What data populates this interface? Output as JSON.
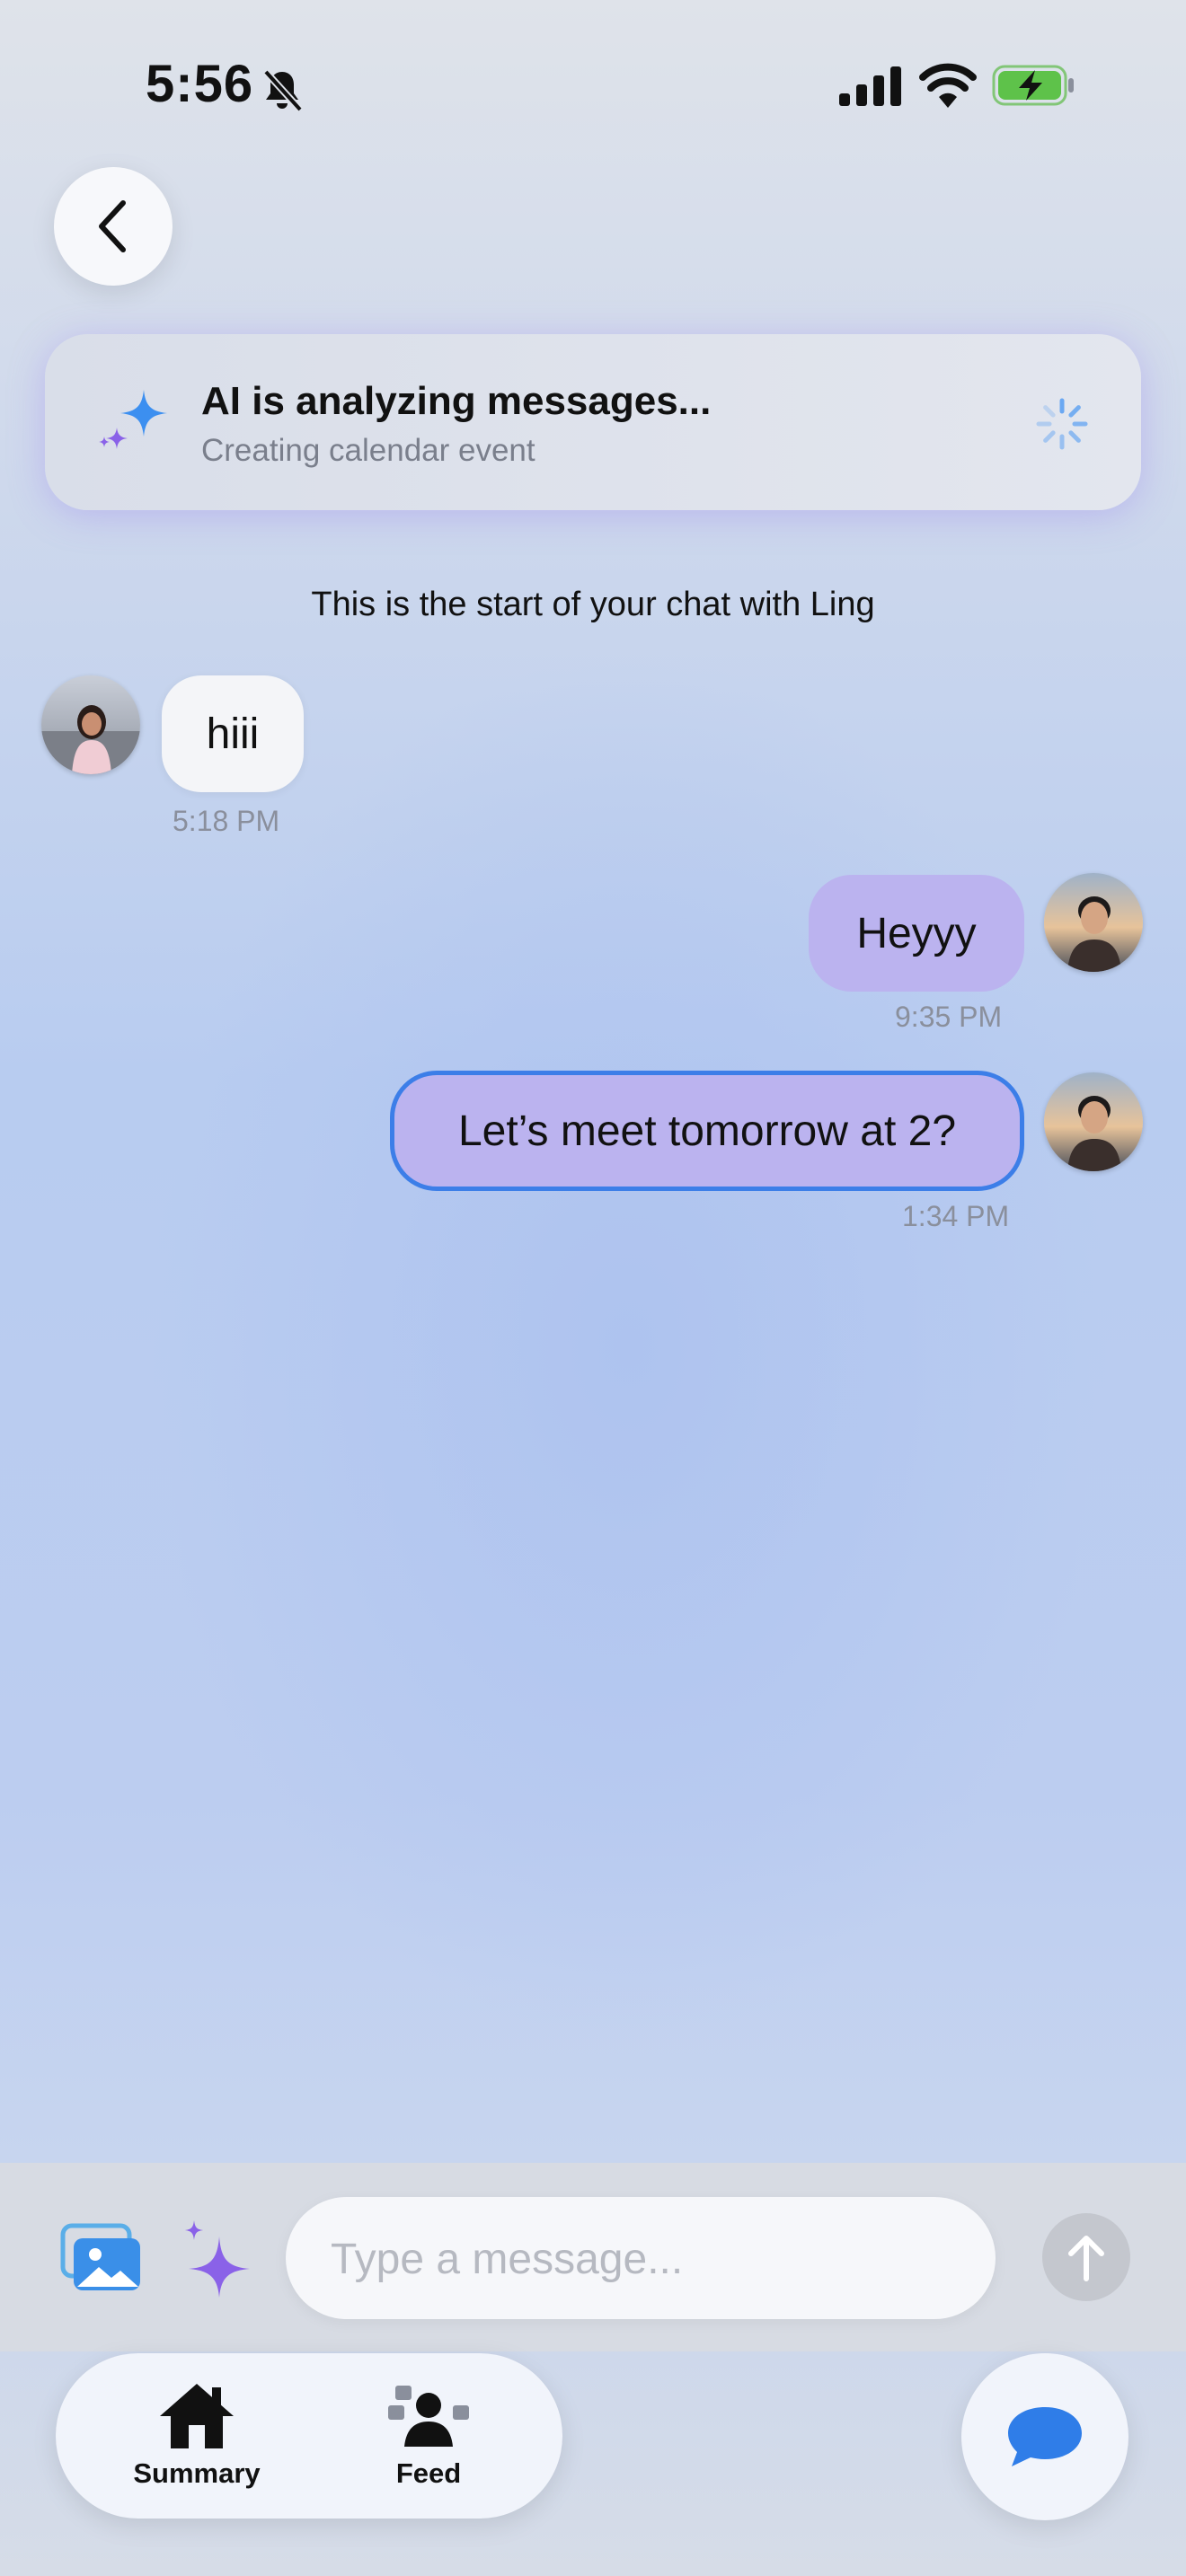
{
  "status_bar": {
    "time": "5:56"
  },
  "header": {
    "back_label": "Back"
  },
  "ai_banner": {
    "title": "AI is analyzing messages...",
    "subtitle": "Creating calendar event"
  },
  "chat": {
    "start_text": "This is the start of your chat with Ling",
    "messages": [
      {
        "sender": "Ling",
        "direction": "incoming",
        "text": "hiii",
        "time": "5:18 PM"
      },
      {
        "sender": "me",
        "direction": "outgoing",
        "text": "Heyyy",
        "time": "9:35 PM"
      },
      {
        "sender": "me",
        "direction": "outgoing",
        "text": "Let’s meet tomorrow at 2?",
        "time": "1:34 PM",
        "selected": true
      }
    ]
  },
  "composer": {
    "placeholder": "Type a message..."
  },
  "tabbar": {
    "tabs": [
      {
        "label": "Summary",
        "icon": "house-icon"
      },
      {
        "label": "Feed",
        "icon": "people-icon"
      }
    ]
  },
  "colors": {
    "outgoing_bubble": "#bbb3ef",
    "incoming_bubble": "#f4f5f8",
    "selection_border": "#3c7ee8",
    "accent_blue": "#2f7de8",
    "sparkle_purple": "#8a62e8"
  }
}
